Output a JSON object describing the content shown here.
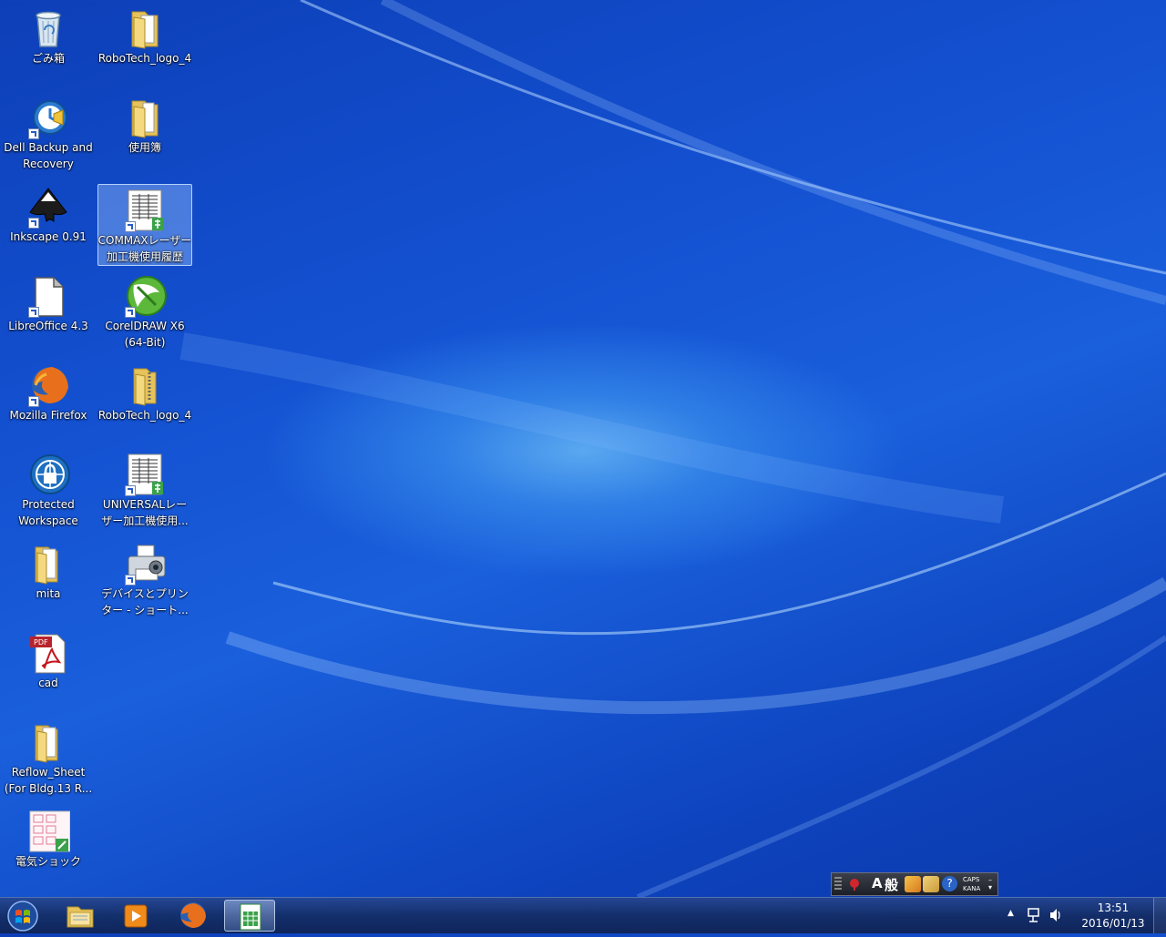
{
  "desktop": {
    "icons": [
      {
        "label": "ごみ箱"
      },
      {
        "label": "RoboTech_logo_4"
      },
      {
        "label": "Dell Backup and\nRecovery"
      },
      {
        "label": "使用簿"
      },
      {
        "label": "Inkscape 0.91"
      },
      {
        "label": "COMMAXレーザー\n加工機使用履歴"
      },
      {
        "label": "LibreOffice 4.3"
      },
      {
        "label": "CorelDRAW X6\n(64-Bit)"
      },
      {
        "label": "Mozilla Firefox"
      },
      {
        "label": "RoboTech_logo_4"
      },
      {
        "label": "Protected\nWorkspace"
      },
      {
        "label": "UNIVERSALレー\nザー加工機使用..."
      },
      {
        "label": "mita"
      },
      {
        "label": "デバイスとプリン\nター - ショート..."
      },
      {
        "label": "cad"
      },
      {
        "label": "Reflow_Sheet\n(For Bldg.13 R..."
      },
      {
        "label": "電気ショック"
      }
    ]
  },
  "ime": {
    "mode": "A",
    "dict": "般",
    "caps": "CAPS",
    "kana": "KANA"
  },
  "icons_text": {
    "pdf": "PDF"
  },
  "clock": {
    "time": "13:51",
    "date": "2016/01/13"
  }
}
